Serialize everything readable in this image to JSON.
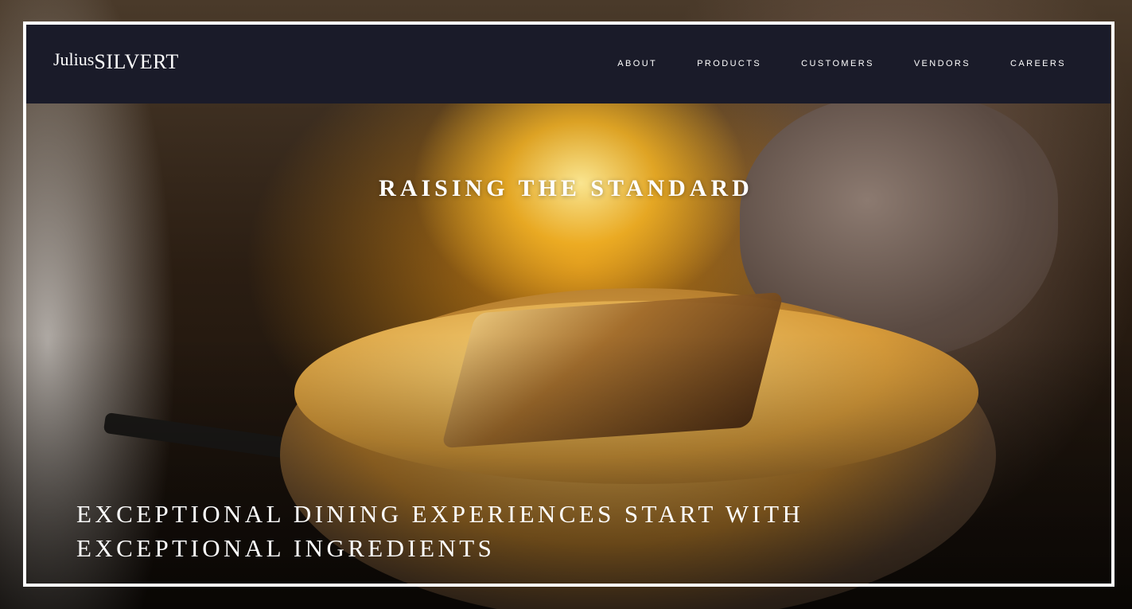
{
  "brand": {
    "first": "Julius",
    "last": "SILVERT"
  },
  "nav": {
    "items": [
      {
        "label": "ABOUT"
      },
      {
        "label": "PRODUCTS"
      },
      {
        "label": "CUSTOMERS"
      },
      {
        "label": "VENDORS"
      },
      {
        "label": "CAREERS"
      }
    ]
  },
  "hero": {
    "title": "RAISING THE STANDARD",
    "tagline_line1": "EXCEPTIONAL DINING EXPERIENCES START WITH",
    "tagline_line2": "EXCEPTIONAL INGREDIENTS"
  },
  "colors": {
    "header_bg": "#1a1b29",
    "frame": "#ffffff",
    "text": "#ffffff"
  }
}
